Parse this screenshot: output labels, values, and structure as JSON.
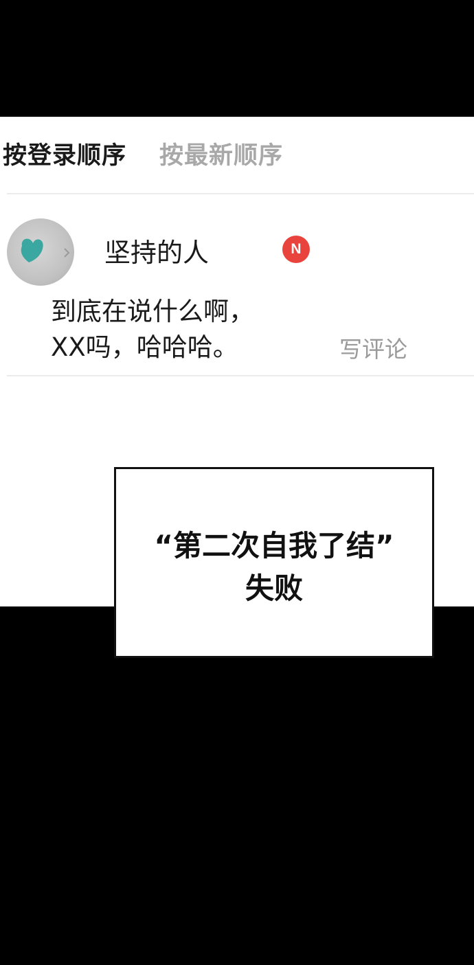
{
  "sort_tabs": {
    "by_login": "按登录顺序",
    "by_newest": "按最新顺序"
  },
  "comment": {
    "username": "坚持的人",
    "badge": "N",
    "lines": [
      "到底在说什么啊，",
      "XX吗，哈哈哈。"
    ],
    "write_comment_label": "写评论"
  },
  "caption": {
    "line1": "“第二次自我了结”",
    "line2": "失败"
  },
  "colors": {
    "background": "#000000",
    "panel": "#ffffff",
    "badge": "#e8433c",
    "active_tab": "#1a1a1a",
    "inactive_tab": "#a8a8a8"
  }
}
